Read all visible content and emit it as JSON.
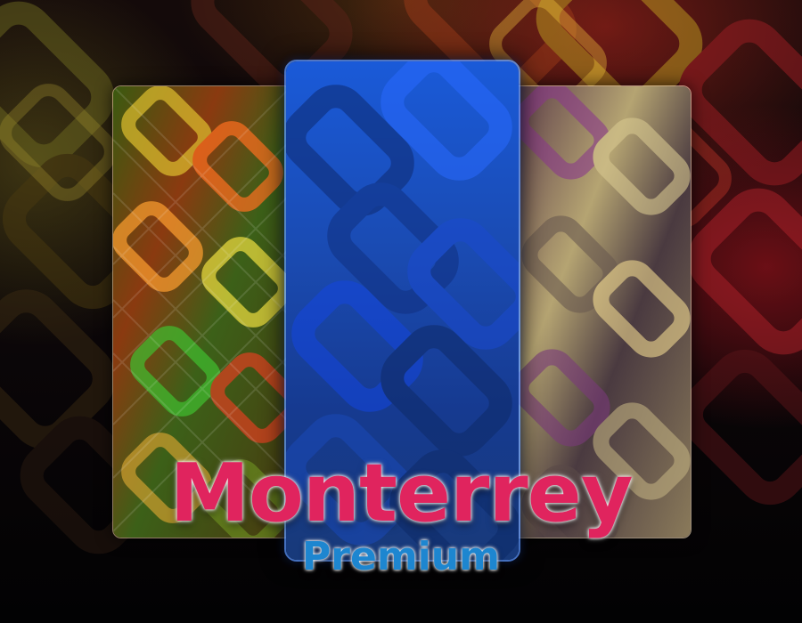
{
  "title": "Monterrey",
  "subtitle": "Premium",
  "colors": {
    "title": "#e0245e",
    "subtitle": "#1d86d0",
    "left_panel": "#c8a030",
    "center_panel": "#1a4fc8",
    "right_panel": "#b9a878",
    "background": "#0b0608"
  },
  "panels": [
    {
      "name": "warm-multicolor-wallpaper"
    },
    {
      "name": "blue-wallpaper"
    },
    {
      "name": "beige-purple-wallpaper"
    }
  ]
}
